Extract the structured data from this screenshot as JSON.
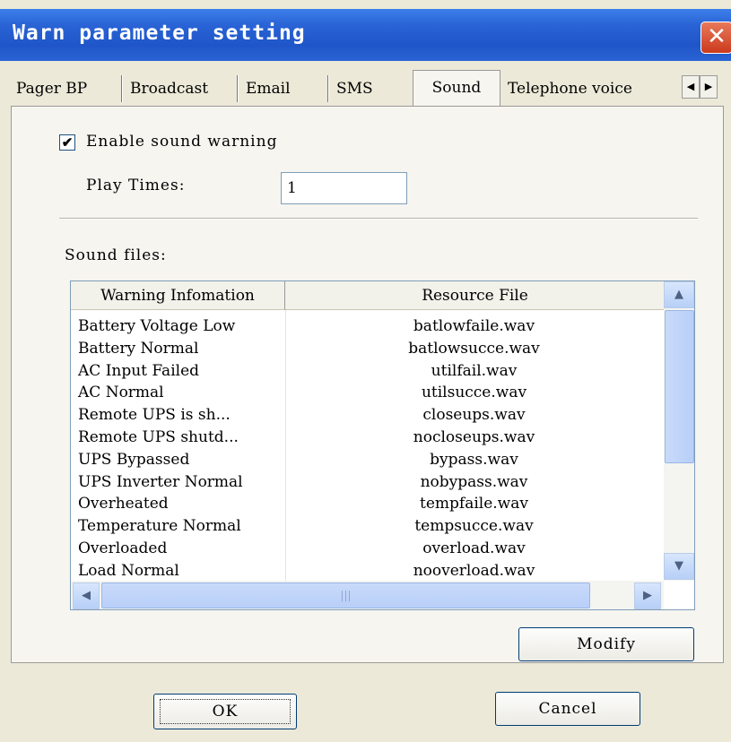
{
  "window": {
    "title": "Warn parameter setting"
  },
  "tabs": [
    "Pager BP",
    "Broadcast",
    "Email",
    "SMS",
    "Sound",
    "Telephone voice"
  ],
  "active_tab": "Sound",
  "sound": {
    "enable_label": "Enable sound warning",
    "enable_checked": true,
    "play_times_label": "Play Times:",
    "play_times_value": "1",
    "sound_files_label": "Sound files:"
  },
  "table": {
    "columns": [
      "Warning Infomation",
      "Resource File"
    ],
    "rows": [
      [
        "Battery Voltage Low",
        "batlowfaile.wav"
      ],
      [
        "Battery Normal",
        "batlowsucce.wav"
      ],
      [
        "AC Input Failed",
        "utilfail.wav"
      ],
      [
        "AC Normal",
        "utilsucce.wav"
      ],
      [
        "Remote UPS is sh...",
        "closeups.wav"
      ],
      [
        "Remote UPS shutd...",
        "nocloseups.wav"
      ],
      [
        "UPS Bypassed",
        "bypass.wav"
      ],
      [
        "UPS Inverter Normal",
        "nobypass.wav"
      ],
      [
        "Overheated",
        "tempfaile.wav"
      ],
      [
        "Temperature Normal",
        "tempsucce.wav"
      ],
      [
        "Overloaded",
        "overload.wav"
      ],
      [
        "Load Normal",
        "nooverload.wav"
      ]
    ]
  },
  "buttons": {
    "modify": "Modify",
    "ok": "OK",
    "cancel": "Cancel"
  },
  "colors": {
    "title_bar": "#2a64d6",
    "close_button": "#d9553a",
    "dialog_bg": "#ece9d8"
  }
}
